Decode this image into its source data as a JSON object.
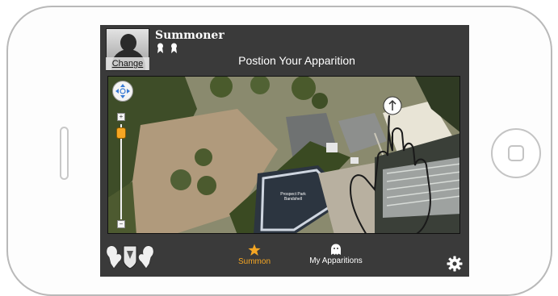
{
  "header": {
    "change_label": "Change",
    "username": "Summoner",
    "title": "Postion Your Apparition"
  },
  "map": {
    "label_line1": "Prospect Park",
    "label_line2": "Bandshell"
  },
  "tabbar": {
    "tabs": [
      {
        "label": "Summon",
        "icon": "star-icon",
        "active": true
      },
      {
        "label": "My Apparitions",
        "icon": "ghost-icon",
        "active": false
      }
    ],
    "settings_icon": "gear-icon"
  },
  "colors": {
    "accent": "#f5a623",
    "bar": "#3a3a3a",
    "text": "#ffffff"
  }
}
